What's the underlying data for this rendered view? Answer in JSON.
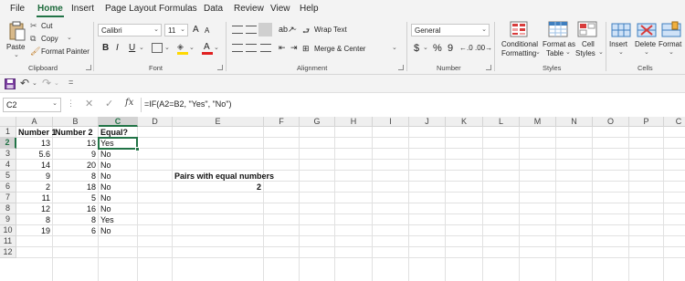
{
  "menu": {
    "tabs": [
      "File",
      "Home",
      "Insert",
      "Page Layout",
      "Formulas",
      "Data",
      "Review",
      "View",
      "Help"
    ]
  },
  "ribbon": {
    "clipboard": {
      "paste": "Paste",
      "cut": "Cut",
      "copy": "Copy",
      "format_painter": "Format Painter",
      "group": "Clipboard"
    },
    "font": {
      "name": "Calibri",
      "size": "11",
      "bold": "B",
      "italic": "I",
      "underline": "U",
      "grow": "A",
      "shrink": "A",
      "font_color": "A",
      "group": "Font"
    },
    "alignment": {
      "wrap_text": "Wrap Text",
      "merge_center": "Merge & Center",
      "group": "Alignment"
    },
    "number": {
      "format": "General",
      "currency": "$",
      "percent": "%",
      "comma": "9",
      "group": "Number"
    },
    "styles": {
      "conditional_1": "Conditional",
      "conditional_2": "Formatting",
      "format_table_1": "Format as",
      "format_table_2": "Table",
      "cell_styles_1": "Cell",
      "cell_styles_2": "Styles",
      "group": "Styles"
    },
    "cells": {
      "insert": "Insert",
      "delete": "Delete",
      "format": "Format",
      "group": "Cells"
    }
  },
  "formula_bar": {
    "name_box": "C2",
    "fx": "fx",
    "formula": "=IF(A2=B2, \"Yes\", \"No\")"
  },
  "sheet": {
    "columns": [
      "A",
      "B",
      "C",
      "D",
      "E",
      "F",
      "G",
      "H",
      "I",
      "J",
      "K",
      "L",
      "M",
      "N",
      "O",
      "P",
      "C"
    ],
    "rows": [
      "1",
      "2",
      "3",
      "4",
      "5",
      "6",
      "7",
      "8",
      "9",
      "10",
      "11",
      "12"
    ],
    "headers": {
      "a1": "Number 1",
      "b1": "Number 2",
      "c1": "Equal?"
    },
    "data": [
      {
        "a": "13",
        "b": "13",
        "c": "Yes"
      },
      {
        "a": "5.6",
        "b": "9",
        "c": "No"
      },
      {
        "a": "14",
        "b": "20",
        "c": "No"
      },
      {
        "a": "9",
        "b": "8",
        "c": "No"
      },
      {
        "a": "2",
        "b": "18",
        "c": "No"
      },
      {
        "a": "11",
        "b": "5",
        "c": "No"
      },
      {
        "a": "12",
        "b": "16",
        "c": "No"
      },
      {
        "a": "8",
        "b": "8",
        "c": "Yes"
      },
      {
        "a": "19",
        "b": "6",
        "c": "No"
      }
    ],
    "summary_label": "Pairs with equal numbers",
    "summary_value": "2"
  },
  "colors": {
    "accent": "#217346"
  }
}
